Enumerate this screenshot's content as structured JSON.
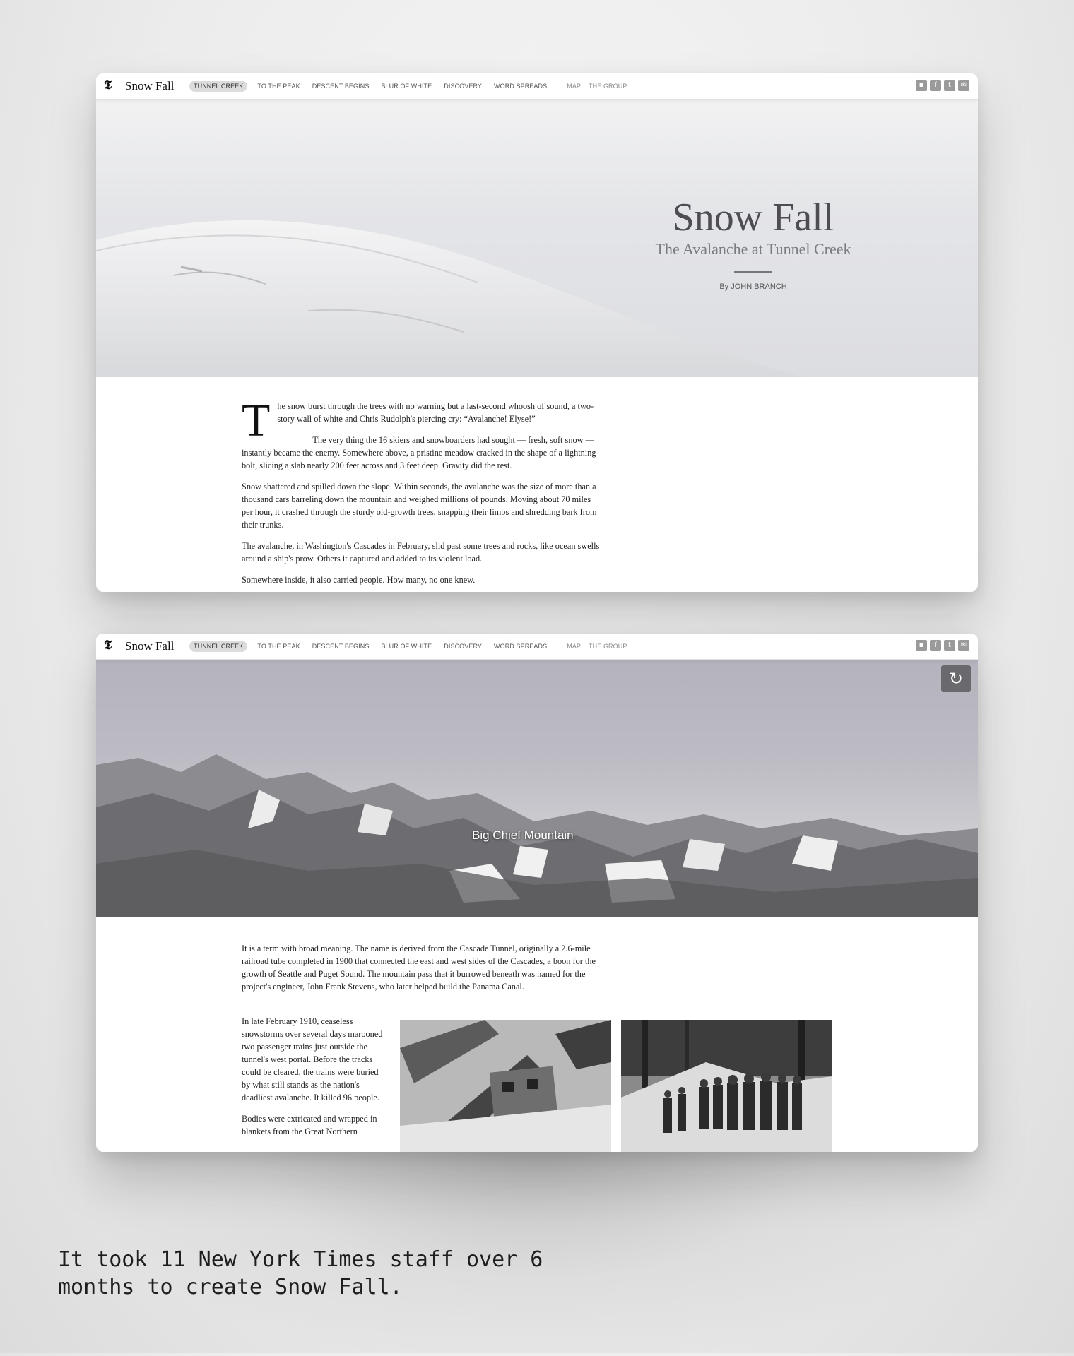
{
  "nav": {
    "brand": "Snow Fall",
    "links": [
      "TUNNEL CREEK",
      "TO THE PEAK",
      "DESCENT BEGINS",
      "BLUR OF WHITE",
      "DISCOVERY",
      "WORD SPREADS"
    ],
    "secondary": [
      "MAP",
      "THE GROUP"
    ],
    "share_icons": [
      "comment-icon",
      "facebook-icon",
      "twitter-icon",
      "email-icon"
    ]
  },
  "page1": {
    "title": "Snow Fall",
    "subtitle": "The Avalanche at Tunnel Creek",
    "byline": "By JOHN BRANCH",
    "dropcap": "T",
    "paragraphs": [
      "he snow burst through the trees with no warning but a last-second whoosh of sound, a two-story wall of white and Chris Rudolph's piercing cry: “Avalanche! Elyse!”",
      "The very thing the 16 skiers and snowboarders had sought — fresh, soft snow — instantly became the enemy. Somewhere above, a pristine meadow cracked in the shape of a lightning bolt, slicing a slab nearly 200 feet across and 3 feet deep. Gravity did the rest.",
      "Snow shattered and spilled down the slope. Within seconds, the avalanche was the size of more than a thousand cars barreling down the mountain and weighed millions of pounds. Moving about 70 miles per hour, it crashed through the sturdy old-growth trees, snapping their limbs and shredding bark from their trunks.",
      "The avalanche, in Washington's Cascades in February, slid past some trees and rocks, like ocean swells around a ship's prow. Others it captured and added to its violent load.",
      "Somewhere inside, it also carried people. How many, no one knew."
    ]
  },
  "page2": {
    "hero_label": "Big Chief Mountain",
    "replay_icon": "replay-icon",
    "paragraph_wide": "It is a term with broad meaning. The name is derived from the Cascade Tunnel, originally a 2.6-mile railroad tube completed in 1900 that connected the east and west sides of the Cascades, a boon for the growth of Seattle and Puget Sound. The mountain pass that it burrowed beneath was named for the project's engineer, John Frank Stevens, who later helped build the Panama Canal.",
    "paragraphs_narrow": [
      "In late February 1910, ceaseless snowstorms over several days marooned two passenger trains just outside the tunnel's west portal. Before the tracks could be cleared, the trains were buried by what still stands as the nation's deadliest avalanche. It killed 96 people.",
      "Bodies were extricated and wrapped in blankets from the Great Northern"
    ]
  },
  "caption": "It took 11 New York Times staff over 6 months to create Snow Fall.",
  "colors": {
    "hero_title": "#4e4e52",
    "nav_active_bg": "#dcdcdc",
    "share_icon": "#9a9a9a"
  }
}
